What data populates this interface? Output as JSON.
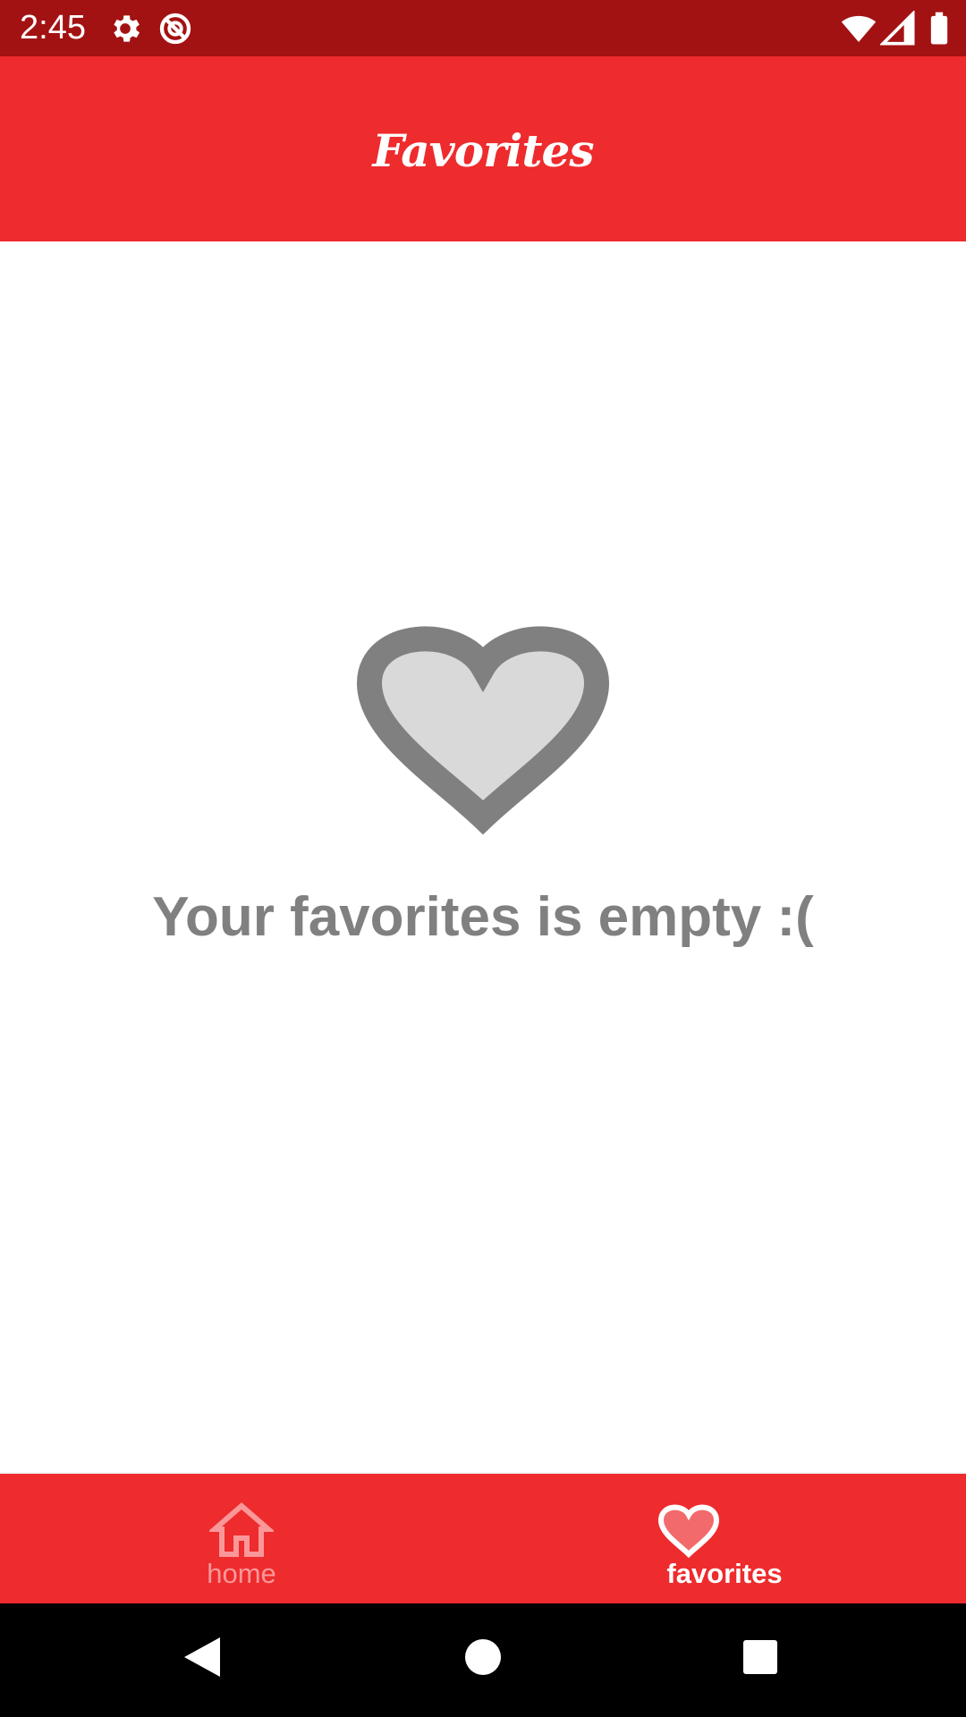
{
  "status_bar": {
    "time": "2:45",
    "icons": [
      "gear-icon",
      "sync-off-icon",
      "wifi-icon",
      "cellular-signal-icon",
      "battery-icon"
    ]
  },
  "app_bar": {
    "title": "Favorites"
  },
  "empty_state": {
    "icon": "heart-outline-icon",
    "message": "Your favorites is empty :("
  },
  "bottom_nav": {
    "items": [
      {
        "label": "home",
        "icon": "home-icon",
        "selected": false
      },
      {
        "label": "favorites",
        "icon": "heart-icon",
        "selected": true
      }
    ]
  },
  "system_nav": {
    "buttons": [
      "back-icon",
      "home-circle-icon",
      "recents-icon"
    ]
  },
  "colors": {
    "status_bar": "#a31212",
    "primary": "#ee2b2d",
    "empty_text": "#808080",
    "heart_fill": "#d9d9d9",
    "heart_outline": "#808080",
    "nav_inactive": "#fa9799",
    "nav_active": "#ffffff"
  }
}
